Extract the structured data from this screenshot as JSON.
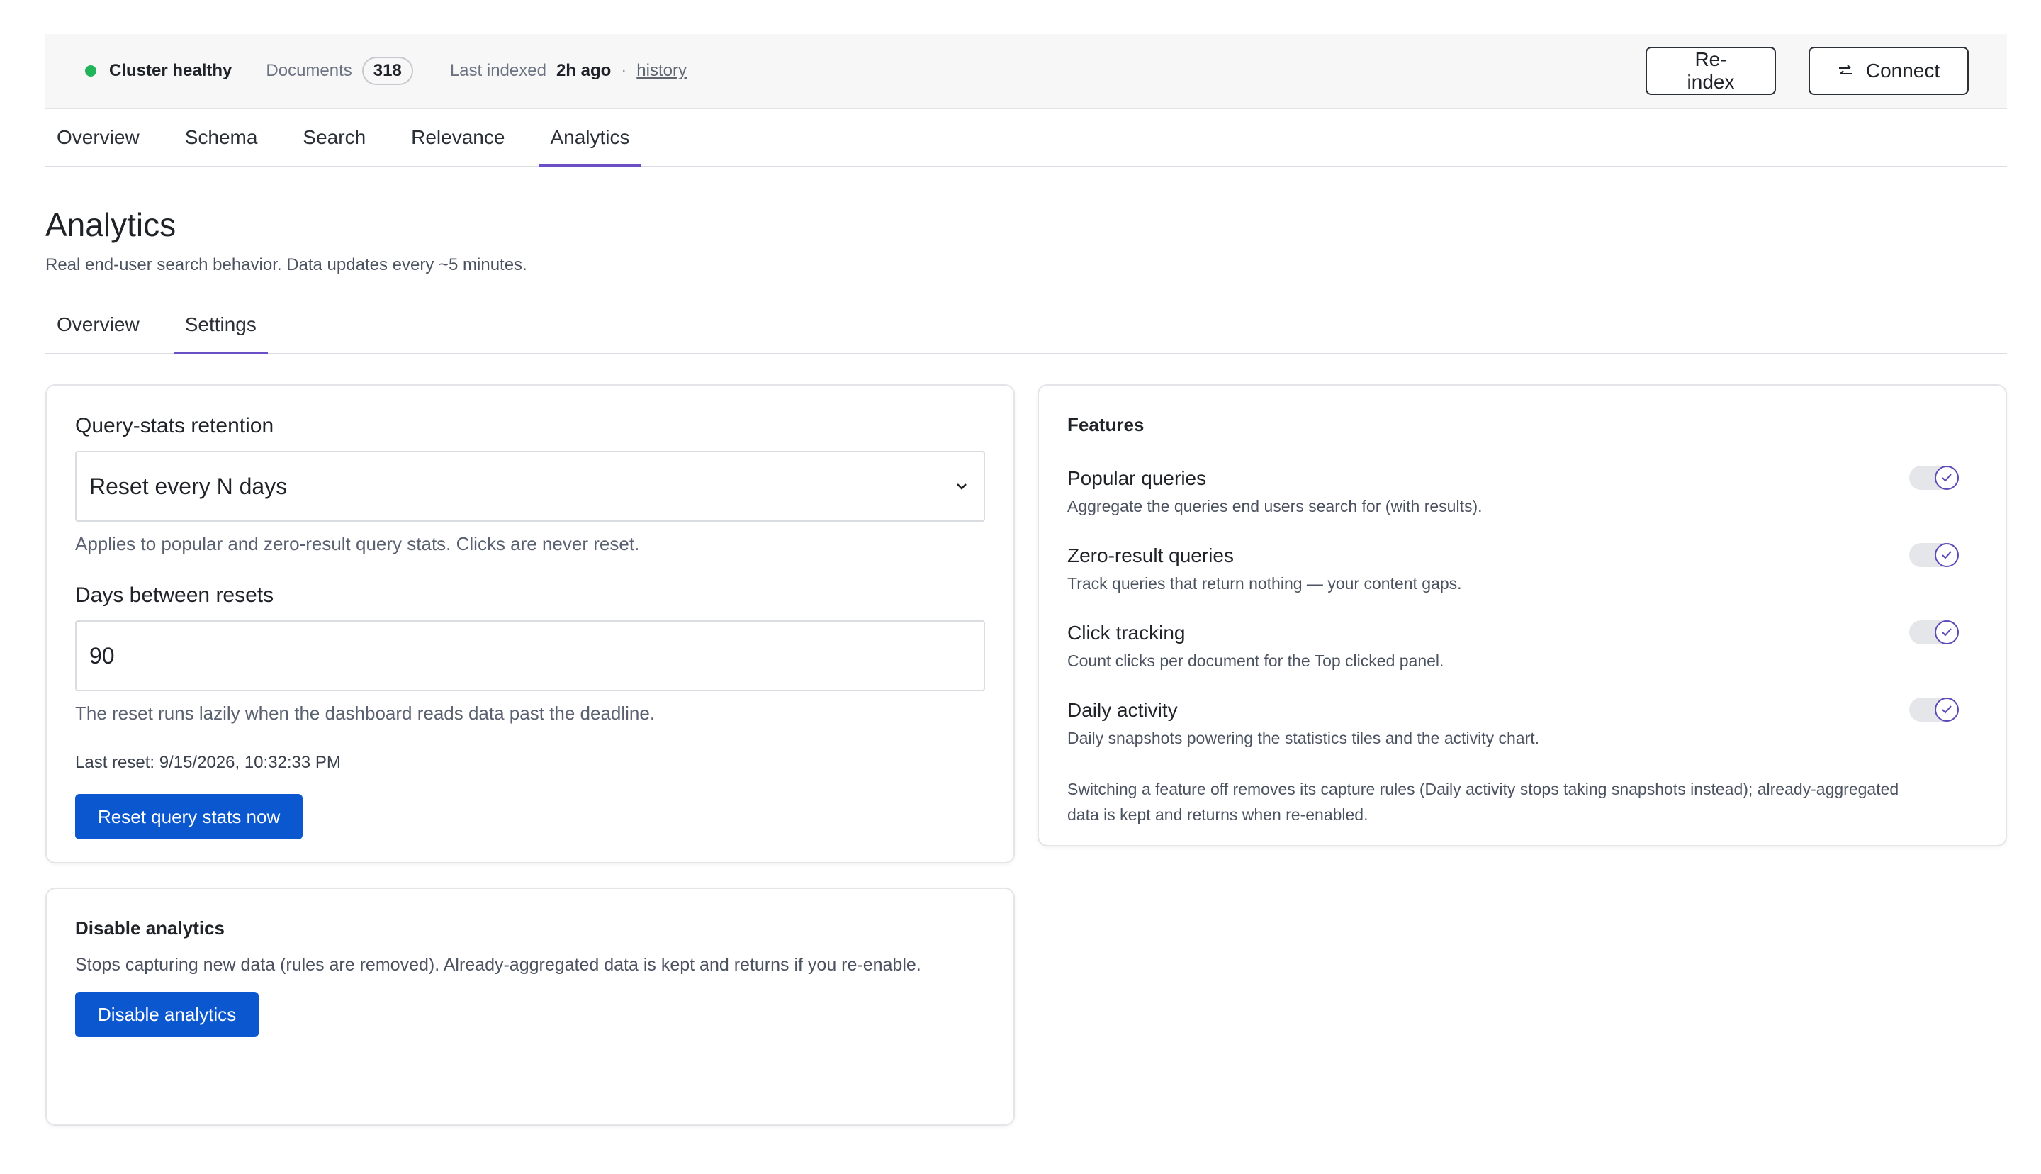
{
  "status": {
    "health": "Cluster healthy",
    "documents_label": "Documents",
    "documents_count": "318",
    "last_indexed_label": "Last indexed",
    "last_indexed_value": "2h ago",
    "separator": "·",
    "history_link": "history",
    "health_color": "#22b45a"
  },
  "actions": {
    "reindex": "Re-index",
    "connect": "Connect"
  },
  "tabs": [
    {
      "label": "Overview"
    },
    {
      "label": "Schema"
    },
    {
      "label": "Search"
    },
    {
      "label": "Relevance"
    },
    {
      "label": "Analytics",
      "active": true
    }
  ],
  "page": {
    "title": "Analytics",
    "subtitle": "Real end-user search behavior. Data updates every ~5 minutes."
  },
  "subtabs": [
    {
      "label": "Overview"
    },
    {
      "label": "Settings",
      "active": true
    }
  ],
  "retention": {
    "label": "Query-stats retention",
    "selected": "Reset every N days",
    "help": "Applies to popular and zero-result query stats. Clicks are never reset.",
    "days_label": "Days between resets",
    "days_value": "90",
    "days_help": "The reset runs lazily when the dashboard reads data past the deadline.",
    "last_reset": "Last reset: 9/15/2026, 10:32:33 PM",
    "reset_button": "Reset query stats now"
  },
  "disable": {
    "title": "Disable analytics",
    "text": "Stops capturing new data (rules are removed). Already-aggregated data is kept and returns if you re-enable.",
    "button": "Disable analytics"
  },
  "features": {
    "title": "Features",
    "items": [
      {
        "name": "Popular queries",
        "desc": "Aggregate the queries end users search for (with results).",
        "enabled": true
      },
      {
        "name": "Zero-result queries",
        "desc": "Track queries that return nothing — your content gaps.",
        "enabled": true
      },
      {
        "name": "Click tracking",
        "desc": "Count clicks per document for the Top clicked panel.",
        "enabled": true
      },
      {
        "name": "Daily activity",
        "desc": "Daily snapshots powering the statistics tiles and the activity chart.",
        "enabled": true
      }
    ],
    "footnote": "Switching a feature off removes its capture rules (Daily activity stops taking snapshots instead); already-aggregated data is kept and returns when re-enabled."
  },
  "colors": {
    "accent": "#6b4fc6",
    "primary_button": "#0b57d0"
  }
}
